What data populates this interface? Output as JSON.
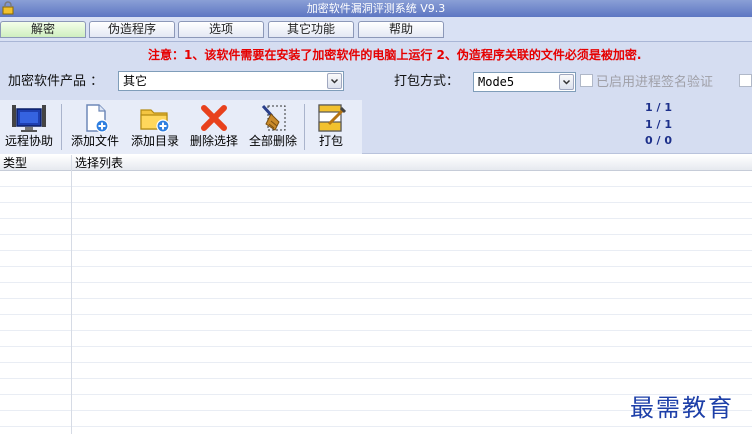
{
  "window": {
    "title": "加密软件漏洞评测系统 V9.3"
  },
  "tabs": [
    {
      "label": "解密"
    },
    {
      "label": "伪造程序"
    },
    {
      "label": "选项"
    },
    {
      "label": "其它功能"
    },
    {
      "label": "帮助"
    }
  ],
  "settings": {
    "notice": "注意：1、该软件需要在安装了加密软件的电脑上运行   2、伪造程序关联的文件必须是被加密.",
    "product_label": "加密软件产品 ：",
    "product_value": "其它",
    "pack_label": "打包方式：",
    "pack_value": "Mode5",
    "signature_label": "已启用进程签名验证"
  },
  "toolbar": {
    "remote": "远程协助",
    "add_file": "添加文件",
    "add_dir": "添加目录",
    "delete_sel": "删除选择",
    "delete_all": "全部删除",
    "pack": "打包",
    "counters": [
      "1 / 1",
      "1 / 1",
      "0 / 0"
    ]
  },
  "list": {
    "columns": [
      "类型",
      "选择列表"
    ]
  },
  "watermark": "最需教育",
  "colors": {
    "notice": "#e60000",
    "title_bar": "#6a82c9",
    "panel": "#d5ddf1",
    "counter": "#1c2f8a",
    "watermark": "#1d3fa8"
  }
}
